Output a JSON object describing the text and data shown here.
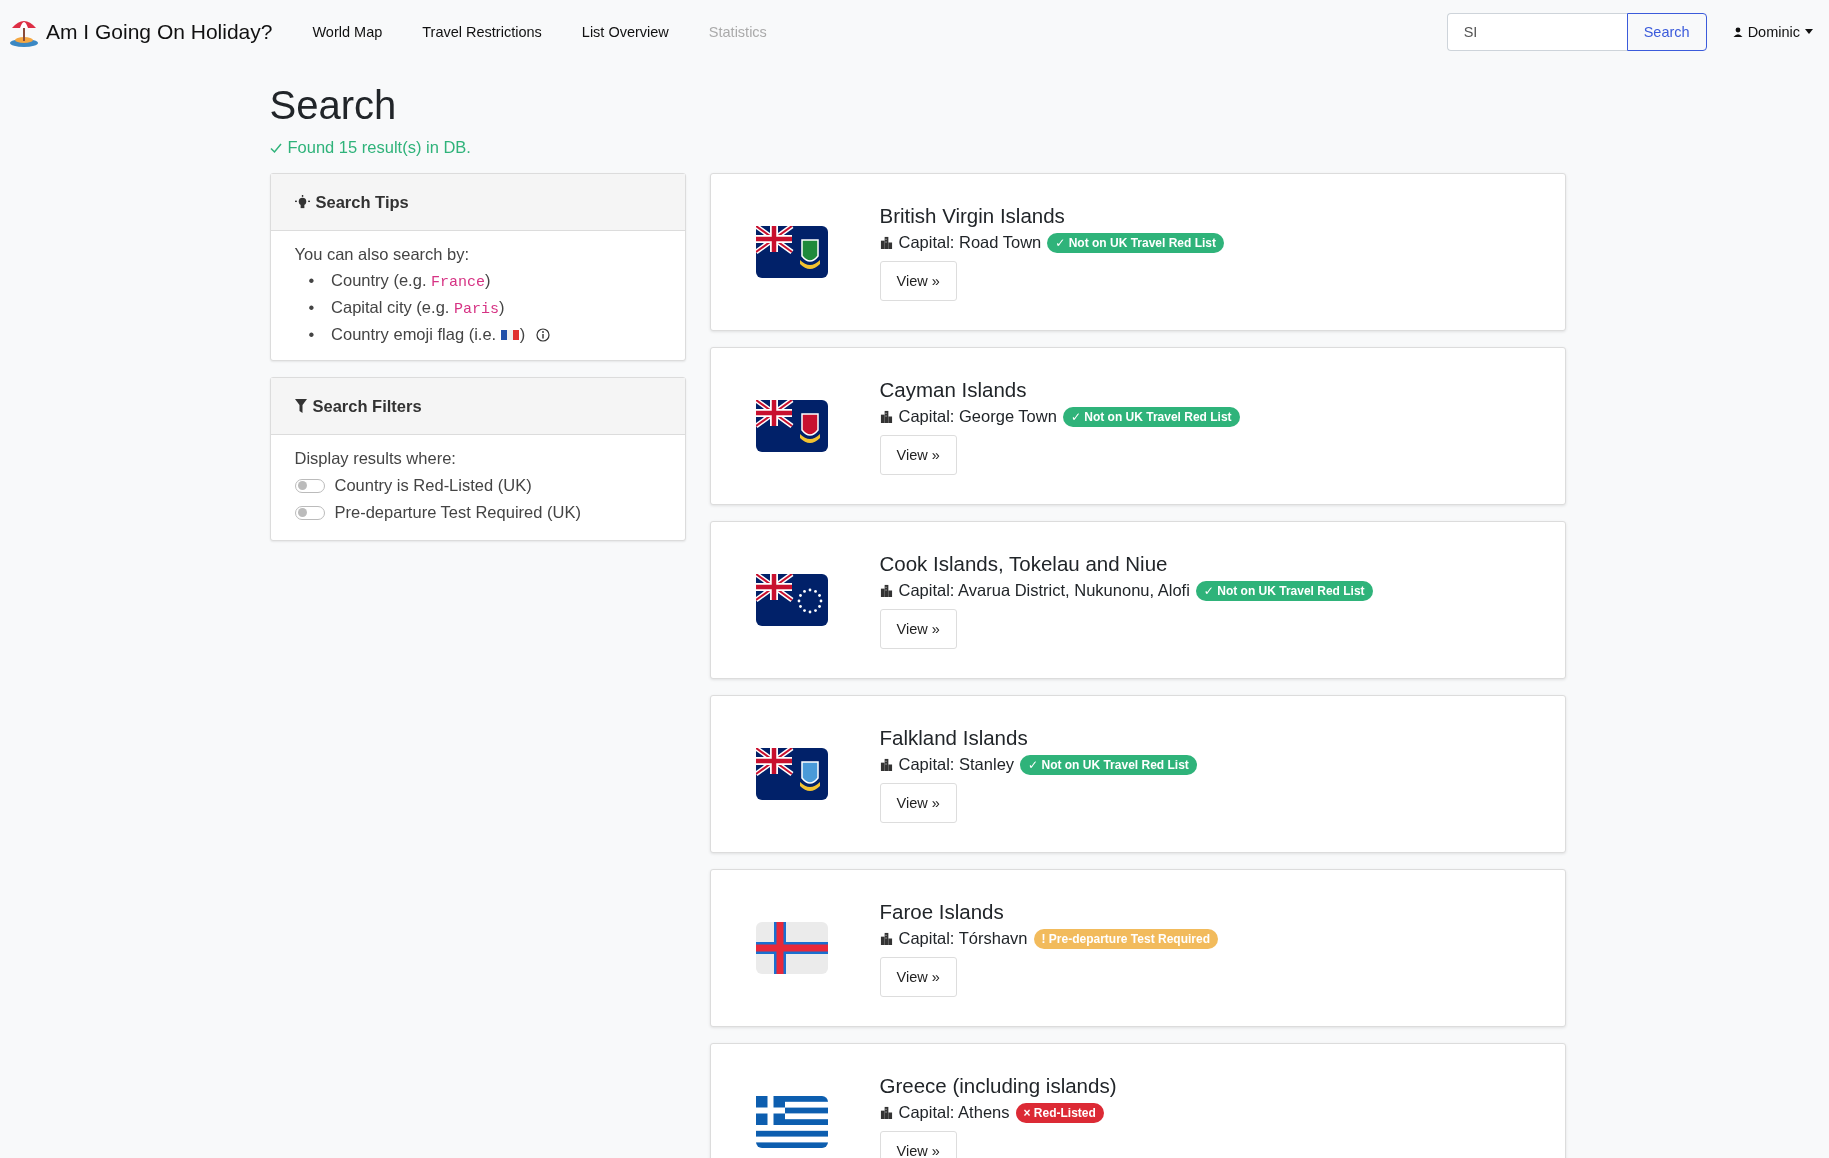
{
  "navbar": {
    "brand": "Am I Going On Holiday?",
    "links": [
      {
        "label": "World Map",
        "disabled": false
      },
      {
        "label": "Travel Restrictions",
        "disabled": false
      },
      {
        "label": "List Overview",
        "disabled": false
      },
      {
        "label": "Statistics",
        "disabled": true
      }
    ],
    "search": {
      "value": "SI",
      "button": "Search"
    },
    "user": "Dominic"
  },
  "heading": "Search",
  "result_message": "Found 15 result(s) in DB.",
  "tips": {
    "title": "Search Tips",
    "intro": "You can also search by:",
    "items": [
      {
        "kind": "code",
        "bullet": "•",
        "text": "Country (e.g. ",
        "code": "France",
        "after": ")"
      },
      {
        "kind": "code",
        "bullet": "•",
        "text": "Capital city (e.g. ",
        "code": "Paris",
        "after": ")"
      },
      {
        "kind": "flag",
        "bullet": "•",
        "text": "Country emoji flag (i.e. ",
        "after": ")"
      }
    ]
  },
  "filters": {
    "title": "Search Filters",
    "intro": "Display results where:",
    "toggles": [
      {
        "label": "Country is Red-Listed (UK)",
        "on": false
      },
      {
        "label": "Pre-departure Test Required (UK)",
        "on": false
      }
    ]
  },
  "results": [
    {
      "name": "British Virgin Islands",
      "capital": "Capital: Road Town",
      "badge": {
        "kind": "clear",
        "icon": "✓",
        "text": "Not on UK Travel Red List"
      },
      "button": "View »"
    },
    {
      "name": "Cayman Islands",
      "capital": "Capital: George Town",
      "badge": {
        "kind": "clear",
        "icon": "✓",
        "text": "Not on UK Travel Red List"
      },
      "button": "View »"
    },
    {
      "name": "Cook Islands, Tokelau and Niue",
      "capital": "Capital: Avarua District, Nukunonu, Alofi",
      "badge": {
        "kind": "clear",
        "icon": "✓",
        "text": "Not on UK Travel Red List"
      },
      "button": "View »"
    },
    {
      "name": "Falkland Islands",
      "capital": "Capital: Stanley",
      "badge": {
        "kind": "clear",
        "icon": "✓",
        "text": "Not on UK Travel Red List"
      },
      "button": "View »"
    },
    {
      "name": "Faroe Islands",
      "capital": "Capital: Tórshavn",
      "badge": {
        "kind": "test",
        "icon": "!",
        "text": "Pre-departure Test Required"
      },
      "button": "View »"
    },
    {
      "name": "Greece (including islands)",
      "capital": "Capital: Athens",
      "badge": {
        "kind": "red",
        "icon": "×",
        "text": "Red-Listed"
      },
      "button": "View »"
    }
  ]
}
